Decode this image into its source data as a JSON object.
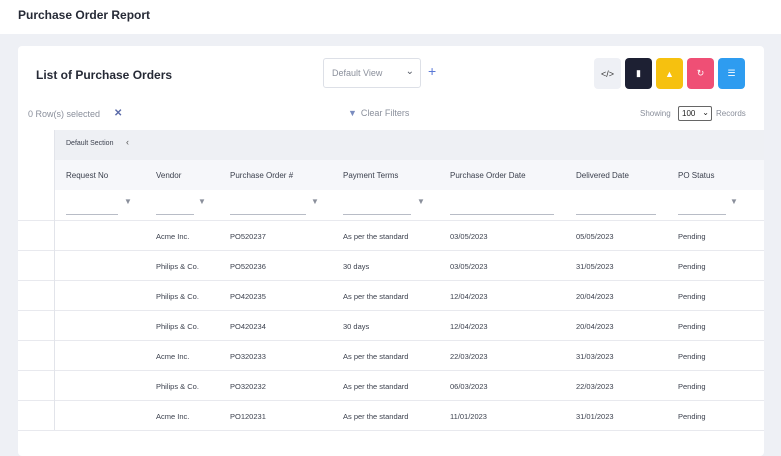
{
  "page": {
    "title": "Purchase Order Report"
  },
  "list": {
    "title": "List of Purchase Orders",
    "view_select": "Default View",
    "view_chevron": "⌄",
    "add_icon": "+"
  },
  "toolbar": {
    "code_icon": "</>",
    "doc_icon": "▮",
    "warn_icon": "▲",
    "refresh_icon": "↻",
    "settings_icon": "☰"
  },
  "selection": {
    "text": "0 Row(s) selected",
    "clear_icon": "✕"
  },
  "filters": {
    "clear_label": "Clear Filters",
    "icon": "▼"
  },
  "paging": {
    "showing": "Showing",
    "page_size": "100",
    "chevron": "⌄",
    "records": "Records"
  },
  "section": {
    "label": "Default Section",
    "chevron": "‹"
  },
  "columns": [
    "Request No",
    "Vendor",
    "Purchase Order #",
    "Payment Terms",
    "Purchase Order Date",
    "Delivered Date",
    "PO Status"
  ],
  "rows": [
    {
      "request_no": "",
      "vendor": "Acme Inc.",
      "po": "PO520237",
      "terms": "As per the standard",
      "po_date": "03/05/2023",
      "delivered": "05/05/2023",
      "status": "Pending"
    },
    {
      "request_no": "",
      "vendor": "Philips & Co.",
      "po": "PO520236",
      "terms": "30 days",
      "po_date": "03/05/2023",
      "delivered": "31/05/2023",
      "status": "Pending"
    },
    {
      "request_no": "",
      "vendor": "Philips & Co.",
      "po": "PO420235",
      "terms": "As per the standard",
      "po_date": "12/04/2023",
      "delivered": "20/04/2023",
      "status": "Pending"
    },
    {
      "request_no": "",
      "vendor": "Philips & Co.",
      "po": "PO420234",
      "terms": "30 days",
      "po_date": "12/04/2023",
      "delivered": "20/04/2023",
      "status": "Pending"
    },
    {
      "request_no": "",
      "vendor": "Acme Inc.",
      "po": "PO320233",
      "terms": "As per the standard",
      "po_date": "22/03/2023",
      "delivered": "31/03/2023",
      "status": "Pending"
    },
    {
      "request_no": "",
      "vendor": "Philips & Co.",
      "po": "PO320232",
      "terms": "As per the standard",
      "po_date": "06/03/2023",
      "delivered": "22/03/2023",
      "status": "Pending"
    },
    {
      "request_no": "",
      "vendor": "Acme Inc.",
      "po": "PO120231",
      "terms": "As per the standard",
      "po_date": "11/01/2023",
      "delivered": "31/01/2023",
      "status": "Pending"
    }
  ]
}
